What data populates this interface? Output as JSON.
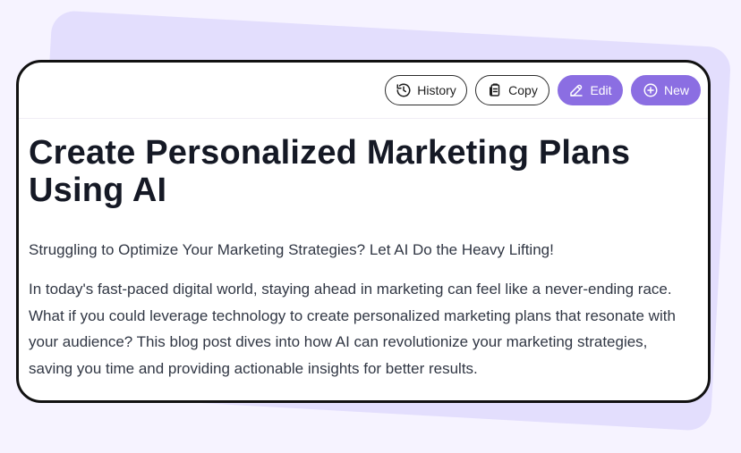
{
  "toolbar": {
    "buttons": [
      {
        "label": "History",
        "icon": "history-icon"
      },
      {
        "label": "Copy",
        "icon": "copy-icon"
      },
      {
        "label": "Edit",
        "icon": "edit-icon"
      },
      {
        "label": "New",
        "icon": "plus-circle-icon"
      }
    ]
  },
  "article": {
    "title": "Create Personalized Marketing Plans Using AI",
    "subtitle": "Struggling to Optimize Your Marketing Strategies? Let AI Do the Heavy Lifting!",
    "body": "In today's fast-paced digital world, staying ahead in marketing can feel like a never-ending race. What if you could leverage technology to create personalized marketing plans that resonate with your audience? This blog post dives into how AI can revolutionize your marketing strategies, saving you time and providing actionable insights for better results."
  },
  "colors": {
    "page_background": "#f6f3ff",
    "backdrop_card": "#e3defd",
    "primary_button": "#8b6ee2",
    "card_border": "#111111",
    "text": "#313744"
  }
}
